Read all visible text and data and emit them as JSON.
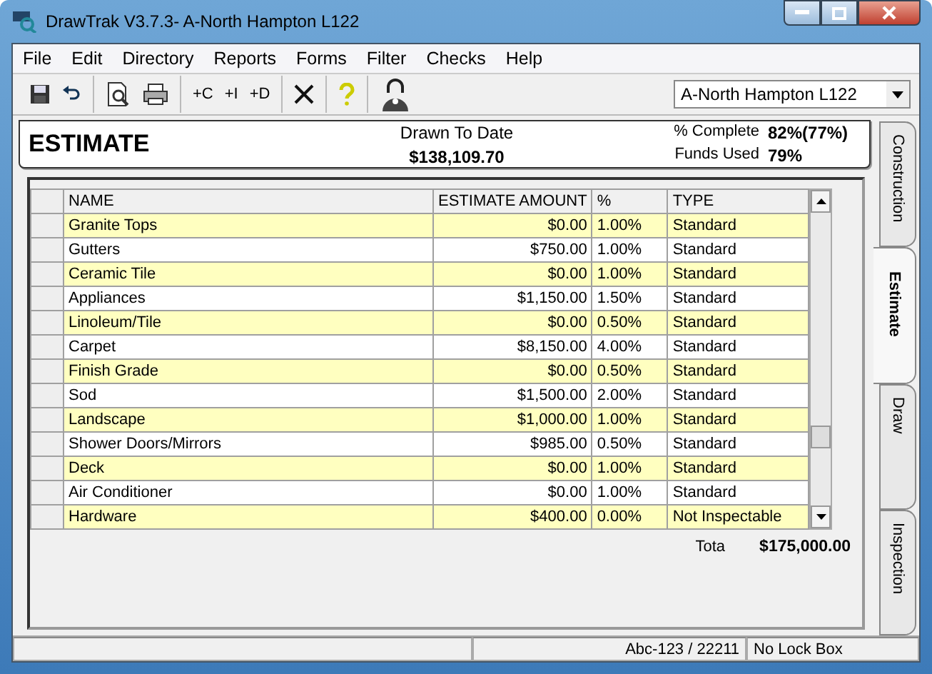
{
  "window": {
    "title": "DrawTrak  V3.7.3- A-North Hampton L122"
  },
  "menu": [
    "File",
    "Edit",
    "Directory",
    "Reports",
    "Forms",
    "Filter",
    "Checks",
    "Help"
  ],
  "toolbar": {
    "add_buttons": [
      "+C",
      "+I",
      "+D"
    ],
    "project_select": {
      "value": "A-North Hampton L122"
    }
  },
  "header": {
    "title": "ESTIMATE",
    "drawn_label": "Drawn To Date",
    "drawn_value": "$138,109.70",
    "complete_label": "% Complete",
    "complete_value": "82%(77%)",
    "funds_label": "Funds Used",
    "funds_value": "79%"
  },
  "table": {
    "columns": [
      "NAME",
      "ESTIMATE AMOUNT",
      "%",
      "TYPE"
    ],
    "rows": [
      {
        "name": "Granite Tops",
        "amount": "$0.00",
        "percent": "1.00%",
        "type": "Standard"
      },
      {
        "name": "Gutters",
        "amount": "$750.00",
        "percent": "1.00%",
        "type": "Standard"
      },
      {
        "name": "Ceramic Tile",
        "amount": "$0.00",
        "percent": "1.00%",
        "type": "Standard"
      },
      {
        "name": "Appliances",
        "amount": "$1,150.00",
        "percent": "1.50%",
        "type": "Standard"
      },
      {
        "name": "Linoleum/Tile",
        "amount": "$0.00",
        "percent": "0.50%",
        "type": "Standard"
      },
      {
        "name": "Carpet",
        "amount": "$8,150.00",
        "percent": "4.00%",
        "type": "Standard"
      },
      {
        "name": "Finish Grade",
        "amount": "$0.00",
        "percent": "0.50%",
        "type": "Standard"
      },
      {
        "name": "Sod",
        "amount": "$1,500.00",
        "percent": "2.00%",
        "type": "Standard"
      },
      {
        "name": "Landscape",
        "amount": "$1,000.00",
        "percent": "1.00%",
        "type": "Standard"
      },
      {
        "name": "Shower Doors/Mirrors",
        "amount": "$985.00",
        "percent": "0.50%",
        "type": "Standard"
      },
      {
        "name": "Deck",
        "amount": "$0.00",
        "percent": "1.00%",
        "type": "Standard"
      },
      {
        "name": "Air Conditioner",
        "amount": "$0.00",
        "percent": "1.00%",
        "type": "Standard"
      },
      {
        "name": "Hardware",
        "amount": "$400.00",
        "percent": "0.00%",
        "type": "Not Inspectable"
      }
    ],
    "total_label": "Tota",
    "total_value": "$175,000.00"
  },
  "side_tabs": [
    {
      "label": "Construction",
      "selected": false
    },
    {
      "label": "Estimate",
      "selected": true
    },
    {
      "label": "Draw",
      "selected": false
    },
    {
      "label": "Inspection",
      "selected": false
    }
  ],
  "status_bar": {
    "record": "Abc-123 / 22211",
    "lock_box": "No Lock Box"
  }
}
